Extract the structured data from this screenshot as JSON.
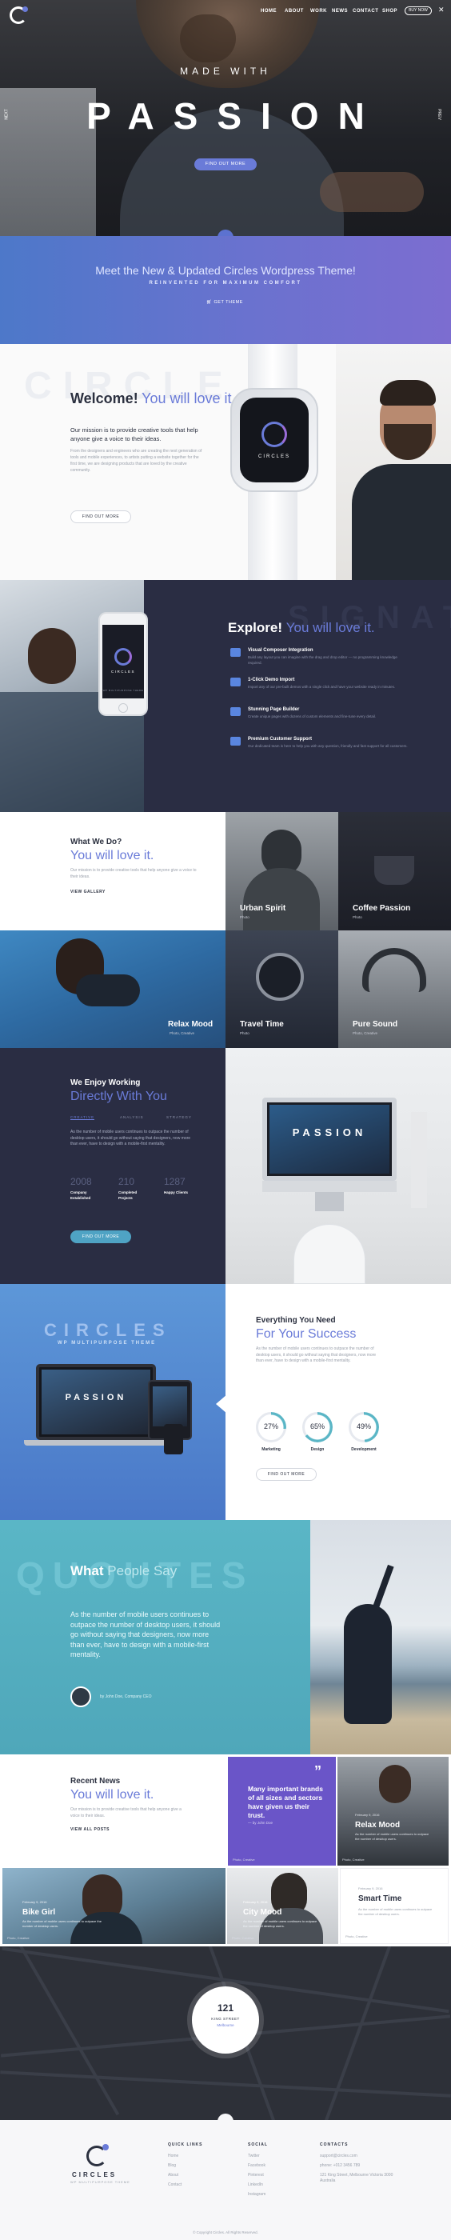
{
  "header": {
    "nav": [
      "HOME",
      "ABOUT",
      "WORK",
      "NEWS",
      "CONTACT",
      "SHOP"
    ],
    "cta": "BUY NOW"
  },
  "hero": {
    "kicker": "MADE WITH",
    "title": "PASSION",
    "button": "FIND OUT MORE",
    "side_left": "NEXT",
    "side_right": "PREV"
  },
  "banner": {
    "title": "Meet the New & Updated Circles Wordpress Theme!",
    "subtitle": "REINVENTED FOR MAXIMUM COMFORT",
    "button": "GET THEME"
  },
  "welcome": {
    "bg_word": "CIRCLE",
    "title_strong": "Welcome!",
    "title_light": "You will love it.",
    "lead": "Our mission is to provide creative tools that help anyone give a voice to their ideas.",
    "body": "From the designers and engineers who are creating the next generation of tools and mobile experiences, to artists putting a website together for the first time, we are designing products that are loved by the creative community.",
    "button": "FIND OUT MORE",
    "watch_label": "CIRCLES"
  },
  "explore": {
    "bg_word": "SIGNATUR",
    "title_strong": "Explore!",
    "title_light": "You will love it.",
    "phone_label": "CIRCLES",
    "phone_sub": "WP MULTIPURPOSE THEME",
    "features": [
      {
        "title": "Visual Composer Integration",
        "text": "Build any layout you can imagine with the drag and drop editor — no programming knowledge required."
      },
      {
        "title": "1-Click Demo Import",
        "text": "Import any of our pre-built demos with a single click and have your website ready in minutes."
      },
      {
        "title": "Stunning Page Builder",
        "text": "Create unique pages with dozens of custom elements and fine-tune every detail."
      },
      {
        "title": "Premium Customer Support",
        "text": "Our dedicated team is here to help you with any question, friendly and fast support for all customers."
      }
    ]
  },
  "what_we_do": {
    "title": "What We Do?",
    "title_light": "You will love it.",
    "text": "Our mission is to provide creative tools that help anyone give a voice to their ideas.",
    "link": "VIEW GALLERY",
    "tiles": [
      {
        "label": "Urban Spirit",
        "sub": "Photo"
      },
      {
        "label": "Coffee Passion",
        "sub": "Photo"
      },
      {
        "label": "Relax Mood",
        "sub": "Photo, Creative"
      },
      {
        "label": "Travel Time",
        "sub": "Photo"
      },
      {
        "label": "Pure Sound",
        "sub": "Photo, Creative"
      }
    ]
  },
  "working": {
    "title": "We Enjoy Working",
    "title_light": "Directly With You",
    "tabs": [
      "CREATIVE",
      "ANALYSIS",
      "STRATEGY"
    ],
    "text": "As the number of mobile users continues to outpace the number of desktop users, it should go without saying that designers, now more than ever, have to design with a mobile-first mentality.",
    "stats": [
      {
        "value": "2008",
        "label": "Company Established"
      },
      {
        "value": "210",
        "label": "Completed Projects"
      },
      {
        "value": "1287",
        "label": "Happy Clients"
      }
    ],
    "button": "FIND OUT MORE",
    "screen_text": "PASSION"
  },
  "needs": {
    "brand": "CIRCLES",
    "brand_sub": "WP MULTIPURPOSE THEME",
    "laptop_text": "PASSION",
    "title": "Everything You Need",
    "title_light": "For Your Success",
    "text": "As the number of mobile users continues to outpace the number of desktop users, it should go without saying that designers, now more than ever, have to design with a mobile-first mentality.",
    "skills": [
      {
        "label": "Marketing",
        "pct": "27%",
        "value": 0.27
      },
      {
        "label": "Design",
        "pct": "65%",
        "value": 0.65
      },
      {
        "label": "Development",
        "pct": "49%",
        "value": 0.49
      }
    ],
    "button": "FIND OUT MORE"
  },
  "quotes": {
    "bg_word": "QUOUTES",
    "title_strong": "What",
    "title_light": "People Say",
    "quote": "As the number of mobile users continues to outpace the number of desktop users, it should go without saying that designers, now more than ever, have to design with a mobile-first mentality.",
    "author": "by John Doe, Company CEO"
  },
  "news": {
    "title": "Recent News",
    "title_light": "You will love it.",
    "text": "Our mission is to provide creative tools that help anyone give a voice to their ideas.",
    "link": "VIEW ALL POSTS",
    "quote_card": {
      "text": "Many important brands of all sizes and sectors have given us their trust.",
      "by": "— by John Doe",
      "foot": "Photo, Creative"
    },
    "cards": [
      {
        "date": "February 9, 2016",
        "title": "Relax Mood",
        "text": "As the number of mobile users continues to outpace the number of desktop users.",
        "foot": "Photo, Creative"
      },
      {
        "date": "February 9, 2016",
        "title": "Bike Girl",
        "text": "As the number of mobile users continues to outpace the number of desktop users.",
        "foot": "Photo, Creative"
      },
      {
        "date": "February 9, 2016",
        "title": "City Mood",
        "text": "As the number of mobile users continues to outpace the number of desktop users.",
        "foot": "Photo, Creative"
      },
      {
        "date": "February 9, 2016",
        "title": "Smart Time",
        "text": "As the number of mobile users continues to outpace the number of desktop users.",
        "foot": "Photo, Creative"
      }
    ]
  },
  "map": {
    "number": "121",
    "line1": "KING STREET",
    "line2": "Melbourne"
  },
  "footer": {
    "brand": "CIRCLES",
    "tag": "WP MULTIPURPOSE THEME",
    "columns": [
      {
        "title": "QUICK LINKS",
        "items": [
          "Home",
          "Blog",
          "About",
          "Contact"
        ]
      },
      {
        "title": "SOCIAL",
        "items": [
          "Twitter",
          "Facebook",
          "Pinterest",
          "LinkedIn",
          "Instagram"
        ]
      },
      {
        "title": "CONTACTS",
        "items": [
          "support@circles.com",
          "phone: +012 3456 789",
          "121 King Street, Melbourne Victoria 3000 Australia"
        ]
      }
    ],
    "copyright": "© Copyright Circles. All Rights Reserved."
  },
  "colors": {
    "accent": "#6a7bd8",
    "dark": "#2a2d43",
    "teal": "#5ab6c6"
  }
}
